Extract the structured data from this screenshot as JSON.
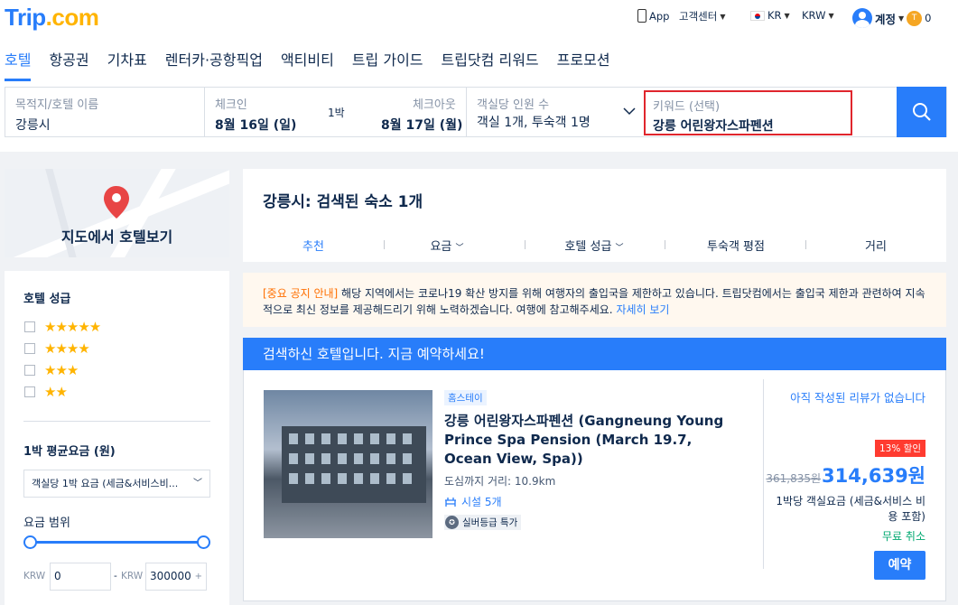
{
  "brand": {
    "name": "Trip",
    "suffix": ".com",
    "color": "#287dfa"
  },
  "header": {
    "app": "App",
    "support": "고객센터",
    "locale": "KR",
    "currency": "KRW",
    "account": "계정",
    "points": "0"
  },
  "nav": {
    "items": [
      {
        "label": "호텔"
      },
      {
        "label": "항공권"
      },
      {
        "label": "기차표"
      },
      {
        "label": "렌터카·공항픽업"
      },
      {
        "label": "액티비티"
      },
      {
        "label": "트립 가이드"
      },
      {
        "label": "트립닷컴 리워드"
      },
      {
        "label": "프로모션"
      }
    ]
  },
  "search": {
    "dest_label": "목적지/호텔 이름",
    "dest_value": "강릉시",
    "checkin_label": "체크인",
    "checkin_value": "8월 16일 (일)",
    "nights": "1박",
    "checkout_label": "체크아웃",
    "checkout_value": "8월 17일 (월)",
    "guests_label": "객실당 인원 수",
    "guests_value": "객실 1개, 투숙객 1명",
    "keyword_label": "키워드 (선택)",
    "keyword_value": "강릉 어린왕자스파펜션"
  },
  "map": {
    "label": "지도에서 호텔보기"
  },
  "filters": {
    "star_title": "호텔 성급",
    "star_options": [
      "★★★★★",
      "★★★★",
      "★★★",
      "★★"
    ],
    "price_title": "1박 평균요금 (원)",
    "price_select": "객실당 1박 요금 (세금&서비스비...",
    "range_title": "요금 범위",
    "currency": "KRW",
    "dash": "-",
    "min": "0",
    "max": "300000",
    "plus": "+"
  },
  "results": {
    "title": "강릉시: 검색된 숙소 1개",
    "sorts": [
      "추천",
      "요금",
      "호텔 성급",
      "투숙객 평점",
      "거리"
    ]
  },
  "notice": {
    "tag": "[중요 공지 안내]",
    "text": " 해당 지역에서는 코로나19 확산 방지를 위해 여행자의 출입국을 제한하고 있습니다. 트립닷컴에서는 출입국 제한과 관련하여 지속적으로 최신 정보를 제공해드리기 위해 노력하겠습니다. 여행에 참고해주세요. ",
    "link": "자세히 보기"
  },
  "banner": {
    "text": "검색하신 호텔입니다. 지금 예약하세요!"
  },
  "hotel": {
    "category": "홈스테이",
    "name": "강릉 어린왕자스파펜션 (Gangneung Young Prince Spa Pension (March 19.7, Ocean View, Spa))",
    "distance": "도심까지 거리: 10.9km",
    "facilities": "시설 5개",
    "badge": "실버등급 특가",
    "review": "아직 작성된 리뷰가 없습니다",
    "discount": "13% 할인",
    "old_price": "361,835원",
    "new_price": "314,639원",
    "price_note": "1박당 객실요금 (세금&서비스 비용 포함)",
    "cancel": "무료 취소",
    "book": "예약"
  }
}
